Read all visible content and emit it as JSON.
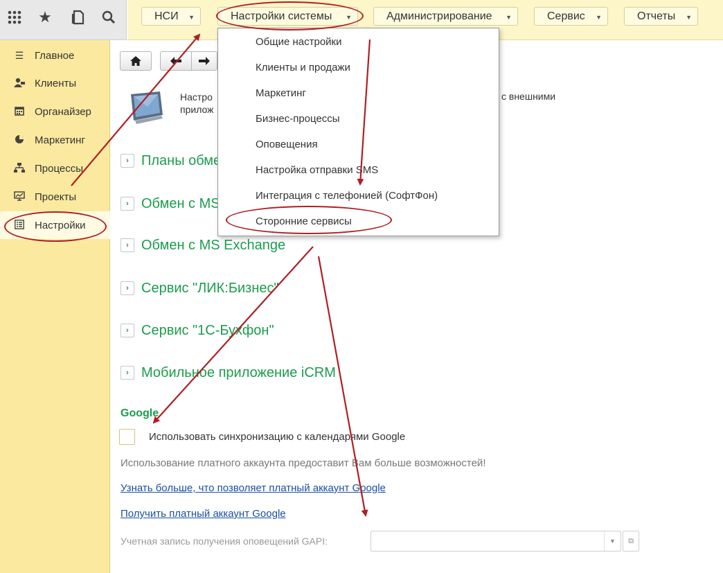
{
  "toolbar": {
    "icons": [
      "apps-grid-icon",
      "star-icon",
      "history-icon",
      "search-icon"
    ]
  },
  "top_menu": [
    {
      "label": "НСИ"
    },
    {
      "label": "Настройки системы"
    },
    {
      "label": "Администрирование"
    },
    {
      "label": "Сервис"
    },
    {
      "label": "Отчеты"
    }
  ],
  "sidebar": {
    "items": [
      {
        "label": "Главное",
        "icon": "menu-lines-icon"
      },
      {
        "label": "Клиенты",
        "icon": "clients-icon"
      },
      {
        "label": "Органайзер",
        "icon": "calendar-icon"
      },
      {
        "label": "Маркетинг",
        "icon": "pie-chart-icon"
      },
      {
        "label": "Процессы",
        "icon": "hierarchy-icon"
      },
      {
        "label": "Проекты",
        "icon": "chart-board-icon"
      },
      {
        "label": "Настройки",
        "icon": "settings-list-icon"
      }
    ]
  },
  "page": {
    "description_line1": "Настро",
    "description_line2": "прилож",
    "description_right": "с внешними"
  },
  "groups": [
    {
      "label": "Планы обме"
    },
    {
      "label": "Обмен с MS"
    },
    {
      "label": "Обмен с  MS Exchange"
    },
    {
      "label": "Сервис \"ЛИК:Бизнес\""
    },
    {
      "label": "Сервис \"1С-Бухфон\""
    },
    {
      "label": "Мобильное приложение  iCRM"
    }
  ],
  "google": {
    "section_title": "Google",
    "checkbox_label": "Использовать синхронизацию с календарями Google",
    "checkbox_checked": false,
    "info_text": "Использование платного аккаунта предоставит Вам больше возможностей!",
    "link_learn": "Узнать больше, что позволяет платный аккаунт Google ",
    "link_get": "Получить платный аккаунт Google",
    "gapi_label": "Учетная запись получения оповещений GAPI:",
    "gapi_value": ""
  },
  "dropdown": {
    "items": [
      {
        "label": "Общие настройки"
      },
      {
        "label": "Клиенты и продажи"
      },
      {
        "label": "Маркетинг"
      },
      {
        "label": "Бизнес-процессы"
      },
      {
        "label": "Оповещения"
      },
      {
        "label": "Настройка отправки SMS"
      },
      {
        "label": "Интеграция с телефонией (СофтФон)"
      },
      {
        "label": "Сторонние сервисы"
      }
    ]
  },
  "colors": {
    "topbar_bg": "#fcf6c8",
    "sidebar_bg": "#fbe99f",
    "group_title": "#1b9c4e",
    "link": "#1a4ea3",
    "annotation": "#b01e23"
  }
}
